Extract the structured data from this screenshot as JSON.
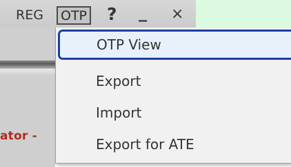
{
  "toolbar": {
    "reg_label": "REG",
    "otp_label": "OTP",
    "help_label": "?",
    "minimize_label": "_",
    "close_label": "×"
  },
  "background": {
    "status_text": "ator -"
  },
  "otp_menu": {
    "items": [
      {
        "label": "OTP View",
        "highlighted": true
      },
      {
        "label": "Export"
      },
      {
        "label": "Import"
      },
      {
        "label": "Export for ATE"
      }
    ]
  },
  "colors": {
    "highlight_border": "#1b3fa0",
    "highlight_fill": "#e8f1fb",
    "status_text": "#b02a1e",
    "right_panel": "#dcfadf"
  }
}
